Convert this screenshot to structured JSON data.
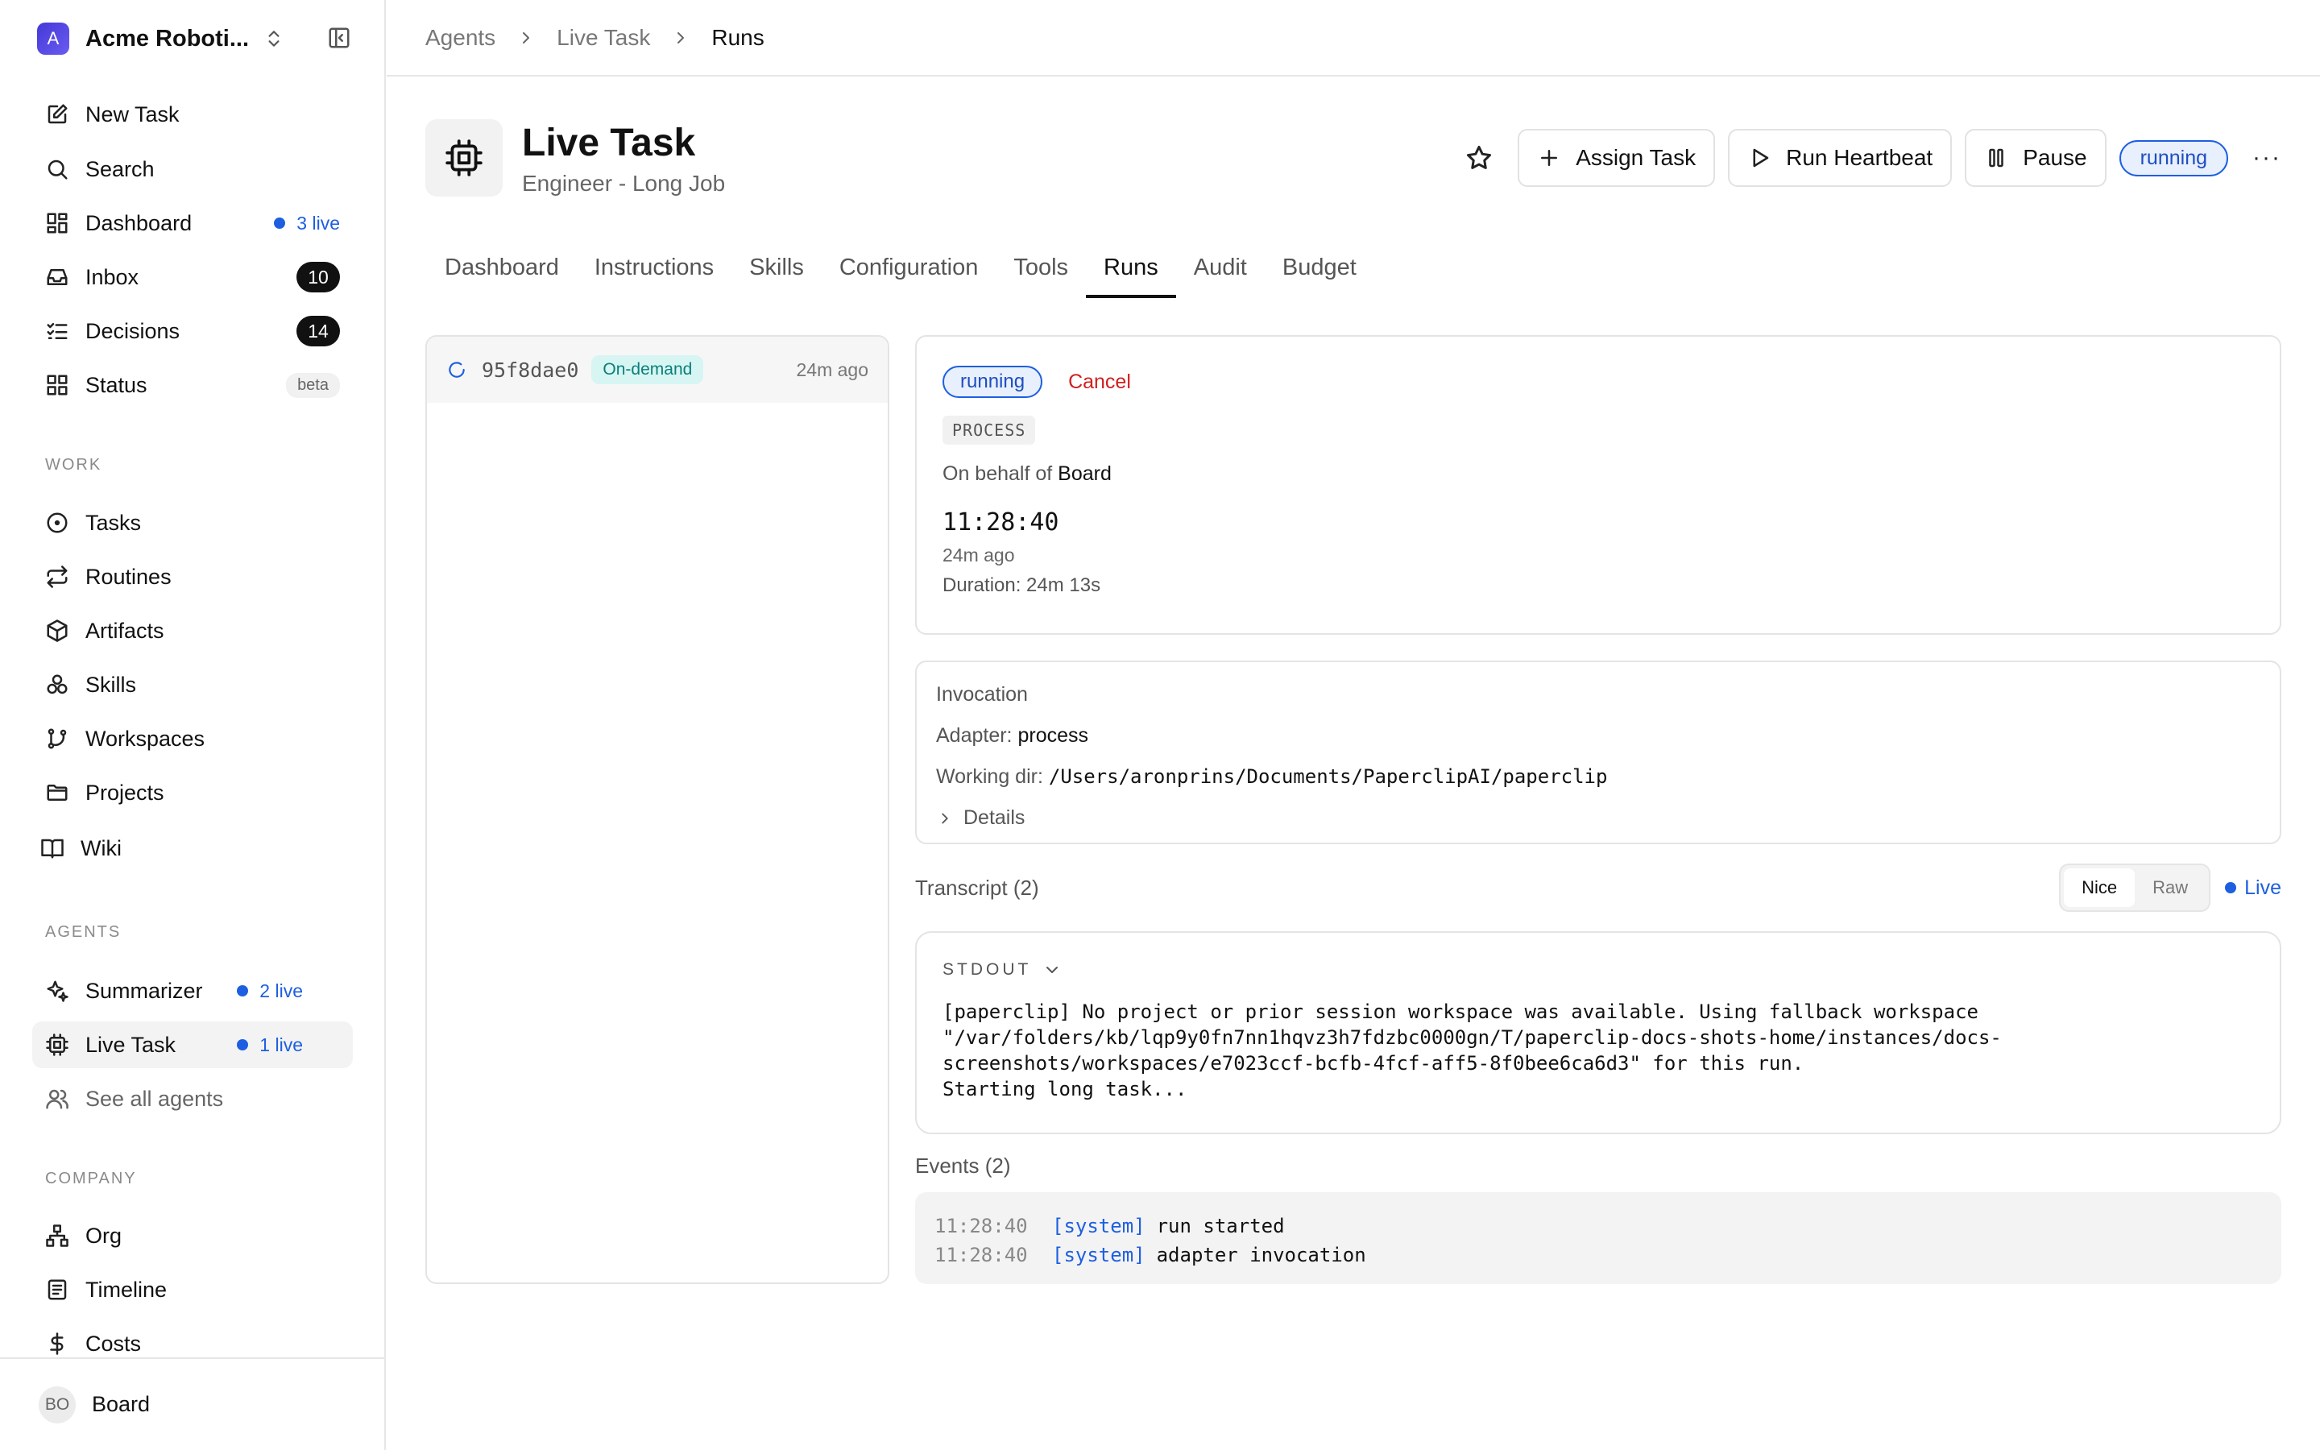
{
  "sidebar": {
    "company_initial": "A",
    "company_name": "Acme Roboti...",
    "nav": [
      {
        "label": "New Task"
      },
      {
        "label": "Search"
      },
      {
        "label": "Dashboard",
        "live": "3 live"
      },
      {
        "label": "Inbox",
        "count": "10"
      },
      {
        "label": "Decisions",
        "count": "14"
      },
      {
        "label": "Status",
        "badge": "beta"
      }
    ],
    "work_label": "WORK",
    "work": [
      {
        "label": "Tasks"
      },
      {
        "label": "Routines"
      },
      {
        "label": "Artifacts"
      },
      {
        "label": "Skills"
      },
      {
        "label": "Workspaces"
      },
      {
        "label": "Projects"
      },
      {
        "label": "Wiki"
      }
    ],
    "agents_label": "AGENTS",
    "agents": [
      {
        "label": "Summarizer",
        "live": "2 live"
      },
      {
        "label": "Live Task",
        "live": "1 live"
      },
      {
        "label": "See all agents"
      }
    ],
    "company_label": "COMPANY",
    "company": [
      {
        "label": "Org"
      },
      {
        "label": "Timeline"
      },
      {
        "label": "Costs"
      }
    ],
    "user": {
      "initials": "BO",
      "name": "Board"
    }
  },
  "breadcrumb": [
    "Agents",
    "Live Task",
    "Runs"
  ],
  "agent": {
    "title": "Live Task",
    "subtitle": "Engineer - Long Job",
    "actions": {
      "assign": "Assign Task",
      "heartbeat": "Run Heartbeat",
      "pause": "Pause"
    },
    "status": "running",
    "more": "···"
  },
  "tabs": [
    "Dashboard",
    "Instructions",
    "Skills",
    "Configuration",
    "Tools",
    "Runs",
    "Audit",
    "Budget"
  ],
  "active_tab": "Runs",
  "runs": [
    {
      "id": "95f8dae0",
      "tag": "On-demand",
      "time": "24m ago"
    }
  ],
  "run_detail": {
    "status": "running",
    "cancel": "Cancel",
    "kind": "PROCESS",
    "behalf_prefix": "On behalf of",
    "behalf": "Board",
    "clock": "11:28:40",
    "ago": "24m ago",
    "duration": "Duration: 24m 13s"
  },
  "invocation": {
    "title": "Invocation",
    "adapter_label": "Adapter:",
    "adapter": "process",
    "dir_label": "Working dir:",
    "dir": "/Users/aronprins/Documents/PaperclipAI/paperclip",
    "details": "Details"
  },
  "transcript": {
    "label": "Transcript (2)",
    "nice": "Nice",
    "raw": "Raw",
    "live": "Live",
    "stream": "STDOUT",
    "text": "[paperclip] No project or prior session workspace was available. Using fallback workspace\n\"/var/folders/kb/lqp9y0fn7nn1hqvz3h7fdzbc0000gn/T/paperclip-docs-shots-home/instances/docs-\nscreenshots/workspaces/e7023ccf-bcfb-4fcf-aff5-8f0bee6ca6d3\" for this run.\nStarting long task..."
  },
  "events": {
    "label": "Events (2)",
    "items": [
      {
        "time": "11:28:40",
        "source": "[system]",
        "message": "run started"
      },
      {
        "time": "11:28:40",
        "source": "[system]",
        "message": "adapter invocation"
      }
    ]
  },
  "colors": {
    "accent": "#1d5fe0",
    "danger": "#d01f1f",
    "tag_bg": "#d6f5f3"
  }
}
